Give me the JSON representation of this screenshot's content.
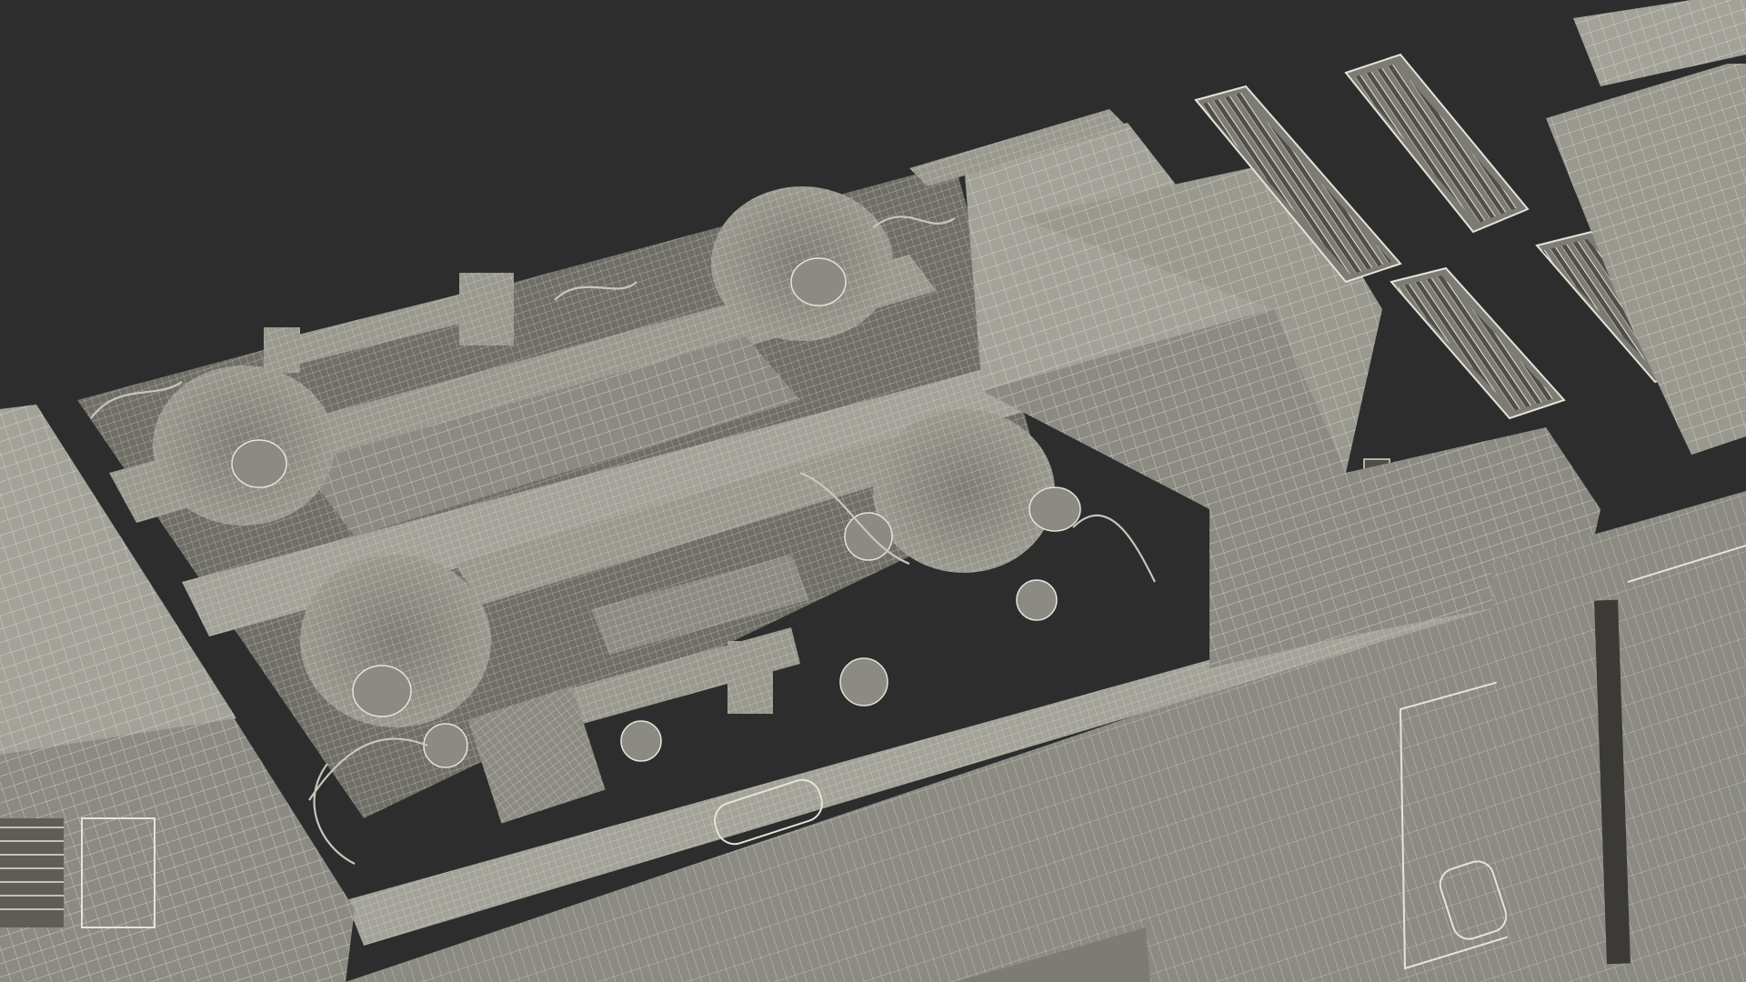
{
  "scene": {
    "subject": "wireframe-render",
    "colors": {
      "background": "#2d2d2d",
      "surface": "#8c8b83",
      "surface_dark": "#6f6e67",
      "surface_light": "#a3a299",
      "wire": "#e6e4d8",
      "shadow": "#4f4e49"
    }
  }
}
